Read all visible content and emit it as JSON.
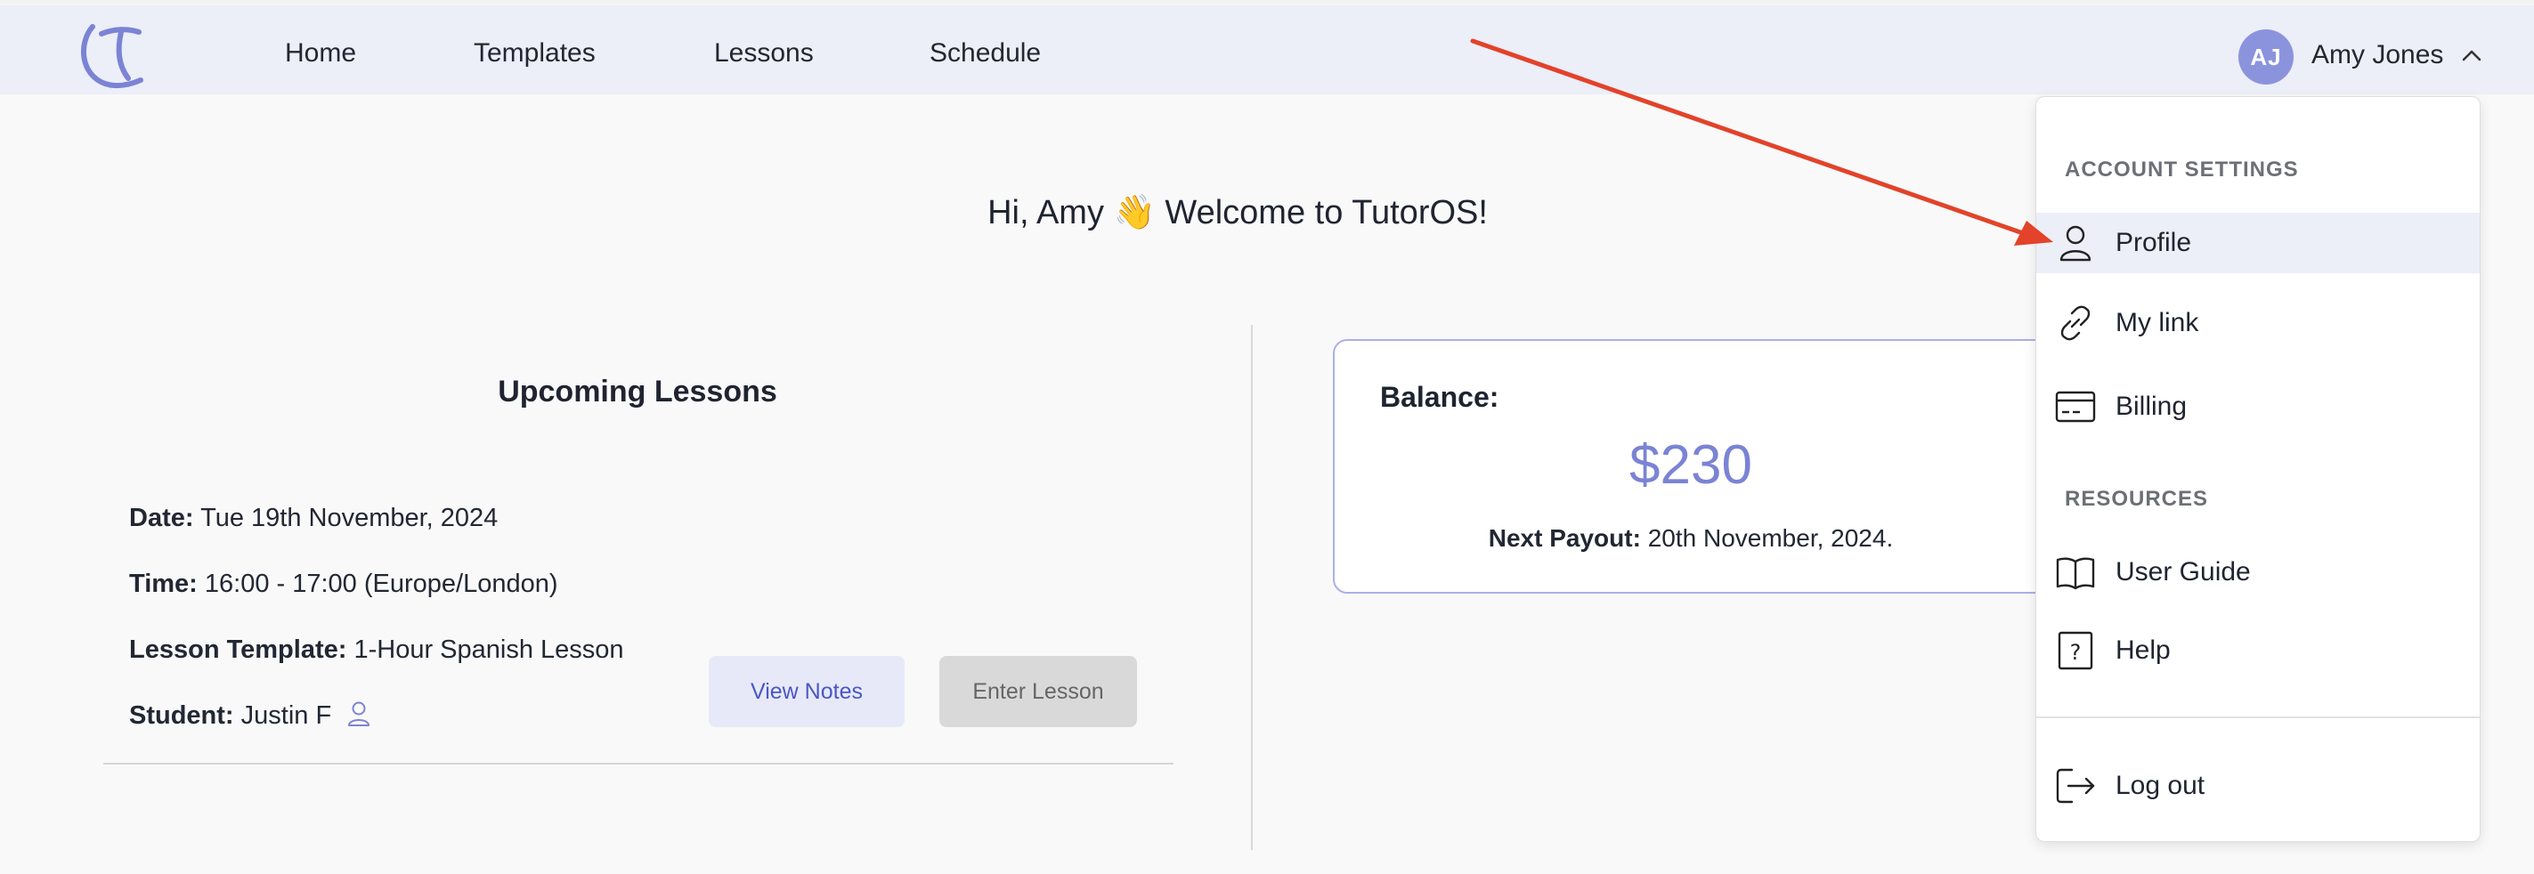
{
  "header": {
    "logo_icon": "tutoros-logo",
    "nav": [
      {
        "label": "Home"
      },
      {
        "label": "Templates"
      },
      {
        "label": "Lessons"
      },
      {
        "label": "Schedule"
      }
    ],
    "user": {
      "initials": "AJ",
      "name": "Amy Jones",
      "menu_icon": "chevron-up-icon"
    }
  },
  "main": {
    "greeting": "Hi, Amy 👋 Welcome to TutorOS!",
    "upcoming": {
      "title": "Upcoming Lessons",
      "lesson": {
        "date_label": "Date:",
        "date_value": "Tue 19th November, 2024",
        "time_label": "Time:",
        "time_value": "16:00 - 17:00 (Europe/London)",
        "template_label": "Lesson Template:",
        "template_value": "1-Hour Spanish Lesson",
        "student_label": "Student:",
        "student_value": "Justin F",
        "student_icon": "user-icon"
      },
      "view_notes_label": "View Notes",
      "enter_lesson_label": "Enter Lesson"
    },
    "balance": {
      "label": "Balance:",
      "amount": "$230",
      "payout_label": "Next Payout:",
      "payout_value": "20th November, 2024."
    }
  },
  "dropdown": {
    "account_heading": "ACCOUNT SETTINGS",
    "account_items": [
      {
        "label": "Profile",
        "icon": "user-icon"
      },
      {
        "label": "My link",
        "icon": "link-icon"
      },
      {
        "label": "Billing",
        "icon": "credit-card-icon"
      }
    ],
    "resources_heading": "RESOURCES",
    "resources_items": [
      {
        "label": "User Guide",
        "icon": "book-icon"
      },
      {
        "label": "Help",
        "icon": "help-icon"
      }
    ],
    "logout_label": "Log out",
    "logout_icon": "logout-icon"
  },
  "colors": {
    "accent": "#7b83d4",
    "header_bg": "#eceef8",
    "annotation_arrow": "#e2432a"
  }
}
